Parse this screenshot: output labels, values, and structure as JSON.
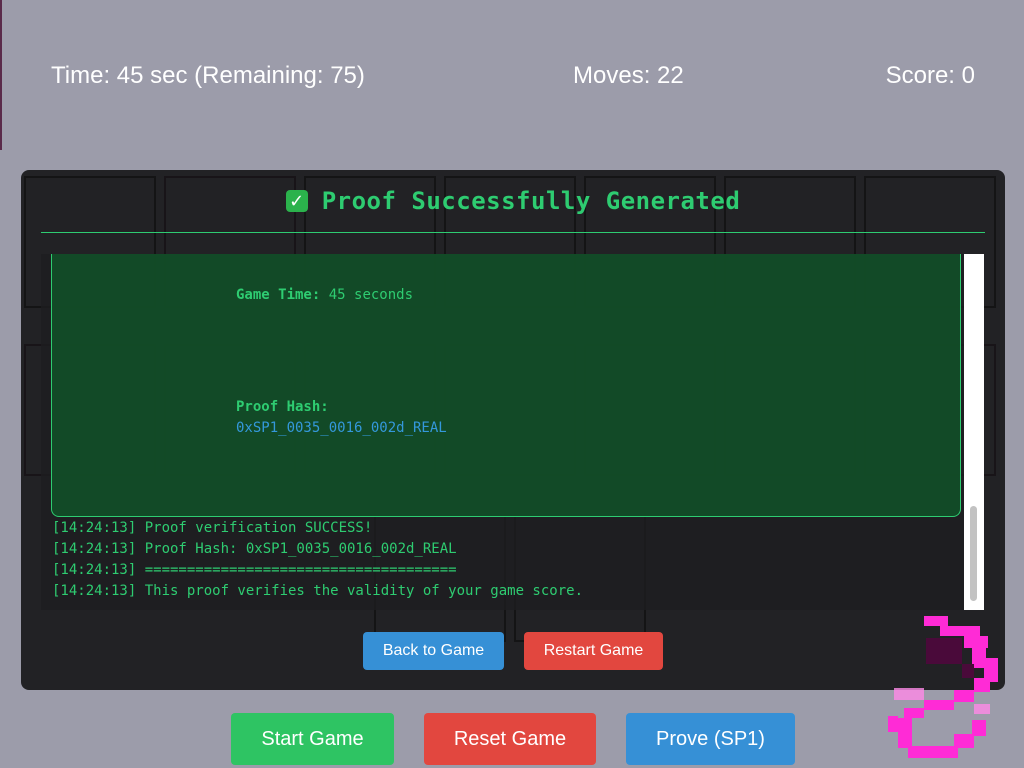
{
  "stats": {
    "time": "Time: 45 sec (Remaining: 75)",
    "moves": "Moves: 22",
    "score": "Score: 0"
  },
  "modal": {
    "title": "Proof Successfully Generated",
    "icon": "check-mark-icon",
    "card": {
      "game_time_label": "Game Time:",
      "game_time_value": "45 seconds",
      "proof_hash_label": "Proof Hash:",
      "proof_hash_value": "0xSP1_0035_0016_002d_REAL"
    },
    "log": [
      "[14:24:13] Proof verification SUCCESS!",
      "[14:24:13] Proof Hash: 0xSP1_0035_0016_002d_REAL",
      "[14:24:13] =====================================",
      "[14:24:13] This proof verifies the validity of your game score."
    ],
    "buttons": {
      "back": "Back to Game",
      "restart": "Restart Game"
    }
  },
  "controls": {
    "start": "Start Game",
    "reset": "Reset Game",
    "prove": "Prove (SP1)"
  },
  "colors": {
    "background": "#9c9caa",
    "accent_green": "#2ecc71",
    "hash_blue": "#3498db",
    "button_green": "#2ec463",
    "button_red": "#e2473f",
    "button_blue": "#3690d6",
    "decoration_pink": "#ff2bd6"
  }
}
